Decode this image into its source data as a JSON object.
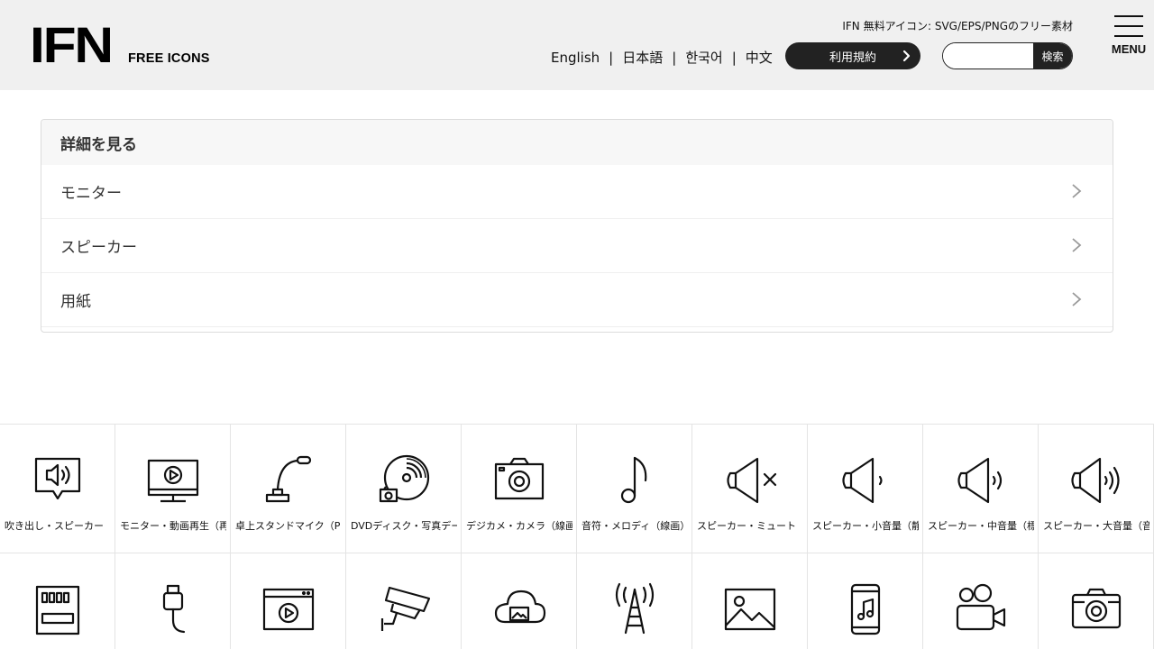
{
  "header": {
    "logo_main": "IFN",
    "logo_sub": "FREE ICONS",
    "tagline": "IFN 無料アイコン: SVG/EPS/PNGのフリー素材",
    "languages": [
      "English",
      "日本語",
      "한국어",
      "中文"
    ],
    "terms_label": "利用規約",
    "search_placeholder": "",
    "search_button": "検索",
    "menu_label": "MENU"
  },
  "details": {
    "title": "詳細を見る",
    "items": [
      "モニター",
      "スピーカー",
      "用紙"
    ]
  },
  "icons": {
    "row1": [
      {
        "icon": "speech-bubble-speaker-icon",
        "caption": "吹き出し・スピーカー"
      },
      {
        "icon": "monitor-video-play-icon",
        "caption": "モニター・動画再生（再"
      },
      {
        "icon": "desk-stand-mic-icon",
        "caption": "卓上スタンドマイク（P"
      },
      {
        "icon": "dvd-disc-photo-icon",
        "caption": "DVDディスク・写真デー"
      },
      {
        "icon": "digital-camera-icon",
        "caption": "デジカメ・カメラ（線画"
      },
      {
        "icon": "music-note-icon",
        "caption": "音符・メロディ（線画）"
      },
      {
        "icon": "speaker-mute-icon",
        "caption": "スピーカー・ミュート"
      },
      {
        "icon": "speaker-low-volume-icon",
        "caption": "スピーカー・小音量（静"
      },
      {
        "icon": "speaker-mid-volume-icon",
        "caption": "スピーカー・中音量（標"
      },
      {
        "icon": "speaker-high-volume-icon",
        "caption": "スピーカー・大音量（音"
      }
    ],
    "row2": [
      {
        "icon": "sd-card-icon",
        "caption": ""
      },
      {
        "icon": "usb-cable-icon",
        "caption": ""
      },
      {
        "icon": "browser-video-icon",
        "caption": ""
      },
      {
        "icon": "security-camera-icon",
        "caption": ""
      },
      {
        "icon": "cloud-image-icon",
        "caption": ""
      },
      {
        "icon": "radio-tower-icon",
        "caption": ""
      },
      {
        "icon": "image-picture-icon",
        "caption": ""
      },
      {
        "icon": "smartphone-music-icon",
        "caption": ""
      },
      {
        "icon": "video-camera-icon",
        "caption": ""
      },
      {
        "icon": "camera-icon",
        "caption": ""
      }
    ]
  }
}
